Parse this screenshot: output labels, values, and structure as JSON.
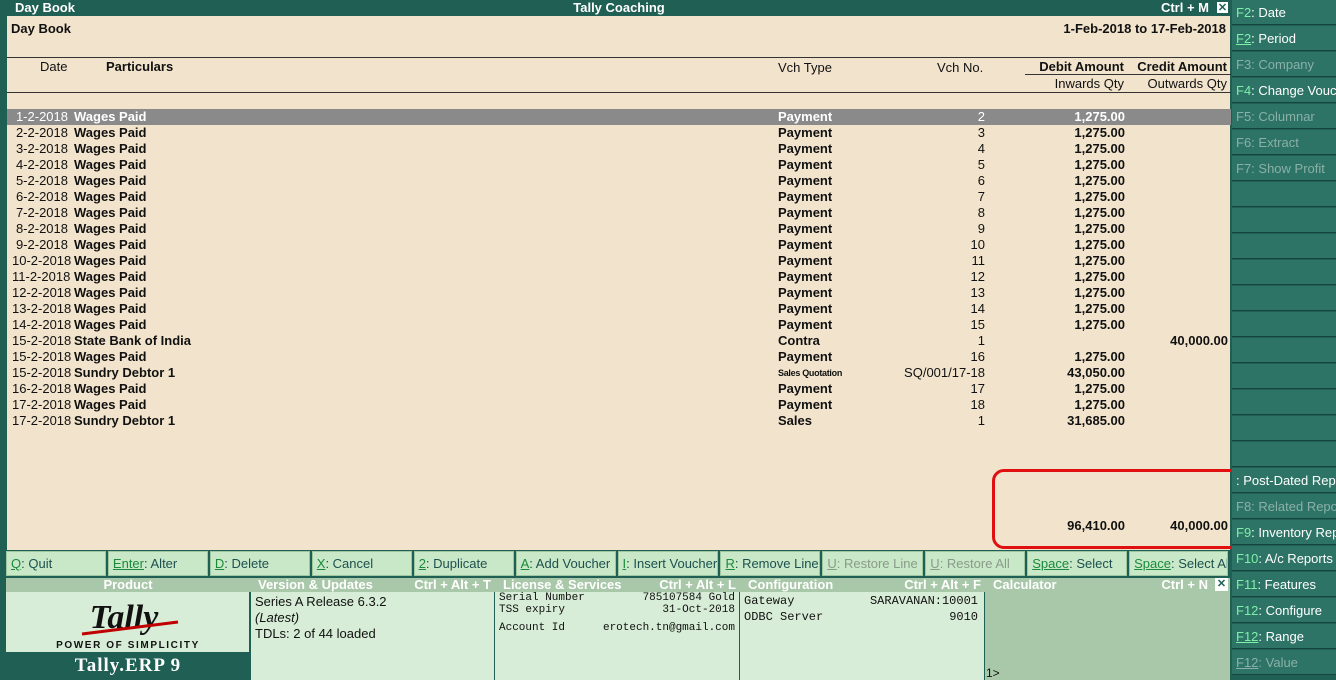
{
  "window": {
    "left_title": "Day Book",
    "center_title": "Tally Coaching",
    "shortcut": "Ctrl + M",
    "close_glyph": "✕"
  },
  "report": {
    "title": "Day Book",
    "period": "1-Feb-2018 to 17-Feb-2018"
  },
  "columns": {
    "date": "Date",
    "particulars": "Particulars",
    "vch_type": "Vch Type",
    "vch_no": "Vch No.",
    "debit": "Debit Amount",
    "credit": "Credit Amount",
    "inwards": "Inwards Qty",
    "outwards": "Outwards Qty"
  },
  "rows": [
    {
      "date": "1-2-2018",
      "particulars": "Wages Paid",
      "type": "Payment",
      "no": "2",
      "debit": "1,275.00",
      "credit": ""
    },
    {
      "date": "2-2-2018",
      "particulars": "Wages Paid",
      "type": "Payment",
      "no": "3",
      "debit": "1,275.00",
      "credit": ""
    },
    {
      "date": "3-2-2018",
      "particulars": "Wages Paid",
      "type": "Payment",
      "no": "4",
      "debit": "1,275.00",
      "credit": ""
    },
    {
      "date": "4-2-2018",
      "particulars": "Wages Paid",
      "type": "Payment",
      "no": "5",
      "debit": "1,275.00",
      "credit": ""
    },
    {
      "date": "5-2-2018",
      "particulars": "Wages Paid",
      "type": "Payment",
      "no": "6",
      "debit": "1,275.00",
      "credit": ""
    },
    {
      "date": "6-2-2018",
      "particulars": "Wages Paid",
      "type": "Payment",
      "no": "7",
      "debit": "1,275.00",
      "credit": ""
    },
    {
      "date": "7-2-2018",
      "particulars": "Wages Paid",
      "type": "Payment",
      "no": "8",
      "debit": "1,275.00",
      "credit": ""
    },
    {
      "date": "8-2-2018",
      "particulars": "Wages Paid",
      "type": "Payment",
      "no": "9",
      "debit": "1,275.00",
      "credit": ""
    },
    {
      "date": "9-2-2018",
      "particulars": "Wages Paid",
      "type": "Payment",
      "no": "10",
      "debit": "1,275.00",
      "credit": ""
    },
    {
      "date": "10-2-2018",
      "particulars": "Wages Paid",
      "type": "Payment",
      "no": "11",
      "debit": "1,275.00",
      "credit": ""
    },
    {
      "date": "11-2-2018",
      "particulars": "Wages Paid",
      "type": "Payment",
      "no": "12",
      "debit": "1,275.00",
      "credit": ""
    },
    {
      "date": "12-2-2018",
      "particulars": "Wages Paid",
      "type": "Payment",
      "no": "13",
      "debit": "1,275.00",
      "credit": ""
    },
    {
      "date": "13-2-2018",
      "particulars": "Wages Paid",
      "type": "Payment",
      "no": "14",
      "debit": "1,275.00",
      "credit": ""
    },
    {
      "date": "14-2-2018",
      "particulars": "Wages Paid",
      "type": "Payment",
      "no": "15",
      "debit": "1,275.00",
      "credit": ""
    },
    {
      "date": "15-2-2018",
      "particulars": "State Bank of India",
      "type": "Contra",
      "no": "1",
      "debit": "",
      "credit": "40,000.00"
    },
    {
      "date": "15-2-2018",
      "particulars": "Wages Paid",
      "type": "Payment",
      "no": "16",
      "debit": "1,275.00",
      "credit": ""
    },
    {
      "date": "15-2-2018",
      "particulars": "Sundry Debtor 1",
      "type": "Sales Quotation",
      "no": "SQ/001/17-18",
      "debit": "43,050.00",
      "credit": ""
    },
    {
      "date": "16-2-2018",
      "particulars": "Wages Paid",
      "type": "Payment",
      "no": "17",
      "debit": "1,275.00",
      "credit": ""
    },
    {
      "date": "17-2-2018",
      "particulars": "Wages Paid",
      "type": "Payment",
      "no": "18",
      "debit": "1,275.00",
      "credit": ""
    },
    {
      "date": "17-2-2018",
      "particulars": "Sundry Debtor 1",
      "type": "Sales",
      "no": "1",
      "debit": "31,685.00",
      "credit": ""
    }
  ],
  "totals": {
    "debit": "96,410.00",
    "credit": "40,000.00"
  },
  "bottom_buttons": [
    {
      "key": "Q",
      "label": ": Quit",
      "disabled": false
    },
    {
      "key": "Enter",
      "label": ": Alter",
      "disabled": false
    },
    {
      "key": "D",
      "label": ": Delete",
      "disabled": false
    },
    {
      "key": "X",
      "label": ": Cancel",
      "disabled": false
    },
    {
      "key": "2",
      "label": ": Duplicate",
      "disabled": false
    },
    {
      "key": "A",
      "label": ": Add Voucher",
      "disabled": false
    },
    {
      "key": "I",
      "label": ": Insert Voucher",
      "disabled": false
    },
    {
      "key": "R",
      "label": ": Remove Line",
      "disabled": false
    },
    {
      "key": "U",
      "label": ": Restore Line",
      "disabled": true
    },
    {
      "key": "U",
      "label": ": Restore All",
      "disabled": true
    },
    {
      "key": "Space",
      "label": ": Select",
      "disabled": false
    },
    {
      "key": "Space",
      "label": ": Select All",
      "disabled": false
    }
  ],
  "info": {
    "product_head": "Product",
    "tagline": "POWER OF SIMPLICITY",
    "product_name": "Tally.ERP 9",
    "logo_text": "Tally",
    "version_head": "Version & Updates",
    "version_shortcut": "Ctrl + Alt + T",
    "version_line1": "Series A Release 6.3.2",
    "version_line2": "(Latest)",
    "version_line3": "TDLs: 2 of 44 loaded",
    "license_head": "License & Services",
    "license_shortcut": "Ctrl + Alt + L",
    "serial_label": "Serial Number",
    "serial_value": "785107584 Gold",
    "tss_label": "TSS expiry",
    "tss_value": "31-Oct-2018",
    "account_label": "Account Id",
    "account_value": "erotech.tn@gmail.com",
    "config_head": "Configuration",
    "config_shortcut": "Ctrl + Alt + F",
    "gateway_label": "Gateway",
    "gateway_value": "SARAVANAN:10001",
    "odbc_label": "ODBC Server",
    "odbc_value": "9010",
    "calc_head": "Calculator",
    "calc_shortcut": "Ctrl + N",
    "calc_prompt": "1>"
  },
  "side_buttons": [
    {
      "key": "F2",
      "label": ": Date",
      "disabled": false,
      "underline": false
    },
    {
      "key": "F2",
      "label": ": Period",
      "disabled": false,
      "underline": true
    },
    {
      "key": "F3",
      "label": ": Company",
      "disabled": true,
      "underline": false
    },
    {
      "key": "F4",
      "label": ": Change Voucher",
      "disabled": false,
      "underline": false
    },
    {
      "key": "F5",
      "label": ": Columnar",
      "disabled": true,
      "underline": false
    },
    {
      "key": "F6",
      "label": ": Extract",
      "disabled": true,
      "underline": false
    },
    {
      "key": "F7",
      "label": ": Show Profit",
      "disabled": true,
      "underline": false
    },
    {
      "key": "",
      "label": "",
      "disabled": false,
      "underline": false
    },
    {
      "key": "",
      "label": "",
      "disabled": false,
      "underline": false
    },
    {
      "key": "",
      "label": "",
      "disabled": false,
      "underline": false
    },
    {
      "key": "",
      "label": "",
      "disabled": false,
      "underline": false
    },
    {
      "key": "",
      "label": "",
      "disabled": false,
      "underline": false
    },
    {
      "key": "",
      "label": "",
      "disabled": false,
      "underline": false
    },
    {
      "key": "",
      "label": "",
      "disabled": false,
      "underline": false
    },
    {
      "key": "",
      "label": "",
      "disabled": false,
      "underline": false
    },
    {
      "key": "",
      "label": "",
      "disabled": false,
      "underline": false
    },
    {
      "key": "",
      "label": "",
      "disabled": false,
      "underline": false
    },
    {
      "key": "",
      "label": "",
      "disabled": false,
      "underline": false
    },
    {
      "key": "",
      "label": ": Post-Dated Reports",
      "disabled": false,
      "underline": false
    },
    {
      "key": "F8",
      "label": ": Related Reports",
      "disabled": true,
      "underline": false
    },
    {
      "key": "F9",
      "label": ": Inventory Reports",
      "disabled": false,
      "underline": false
    },
    {
      "key": "F10",
      "label": ": A/c Reports",
      "disabled": false,
      "underline": false
    },
    {
      "key": "F11",
      "label": ": Features",
      "disabled": false,
      "underline": false
    },
    {
      "key": "F12",
      "label": ": Configure",
      "disabled": false,
      "underline": false
    },
    {
      "key": "F12",
      "label": ": Range",
      "disabled": false,
      "underline": true
    },
    {
      "key": "F12",
      "label": ": Value",
      "disabled": true,
      "underline": true
    }
  ]
}
